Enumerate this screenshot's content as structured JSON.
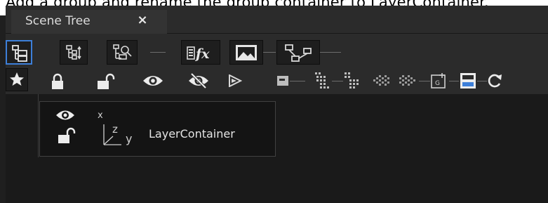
{
  "caption": "Add a group and rename the group container to LayerContainer.",
  "panel": {
    "tab": {
      "label": "Scene Tree",
      "close_symbol": "×"
    }
  },
  "toolbar_primary": {
    "buttons": [
      {
        "icon": "tree-view-icon",
        "active": true
      },
      {
        "icon": "tree-sort-icon",
        "active": false
      },
      {
        "icon": "tree-search-icon",
        "active": false
      },
      {
        "icon": "effects-icon",
        "label": "fx",
        "active": false
      },
      {
        "icon": "image-icon",
        "active": false
      },
      {
        "icon": "node-graph-icon",
        "active": false
      }
    ]
  },
  "toolbar_secondary": {
    "icons": [
      "star-icon",
      "lock-icon",
      "unlock-icon",
      "eye-icon",
      "eye-off-icon",
      "play-right-icon",
      "flag-icon",
      "group-expand-icon",
      "group-collapse-icon",
      "move-left-icon",
      "move-right-icon",
      "add-group-icon",
      "layout-icon",
      "refresh-icon"
    ]
  },
  "tree": {
    "nodes": [
      {
        "name": "LayerContainer",
        "icons": [
          "eye-icon",
          "unlock-icon",
          "axis-icon"
        ],
        "axis_labels": {
          "x": "x",
          "z": "z",
          "y": "y"
        }
      }
    ]
  },
  "colors": {
    "panel_bg": "#2b2b2b",
    "tree_bg": "#1a1a1a",
    "accent": "#3d7fd9",
    "icon": "#e6e6e6"
  }
}
